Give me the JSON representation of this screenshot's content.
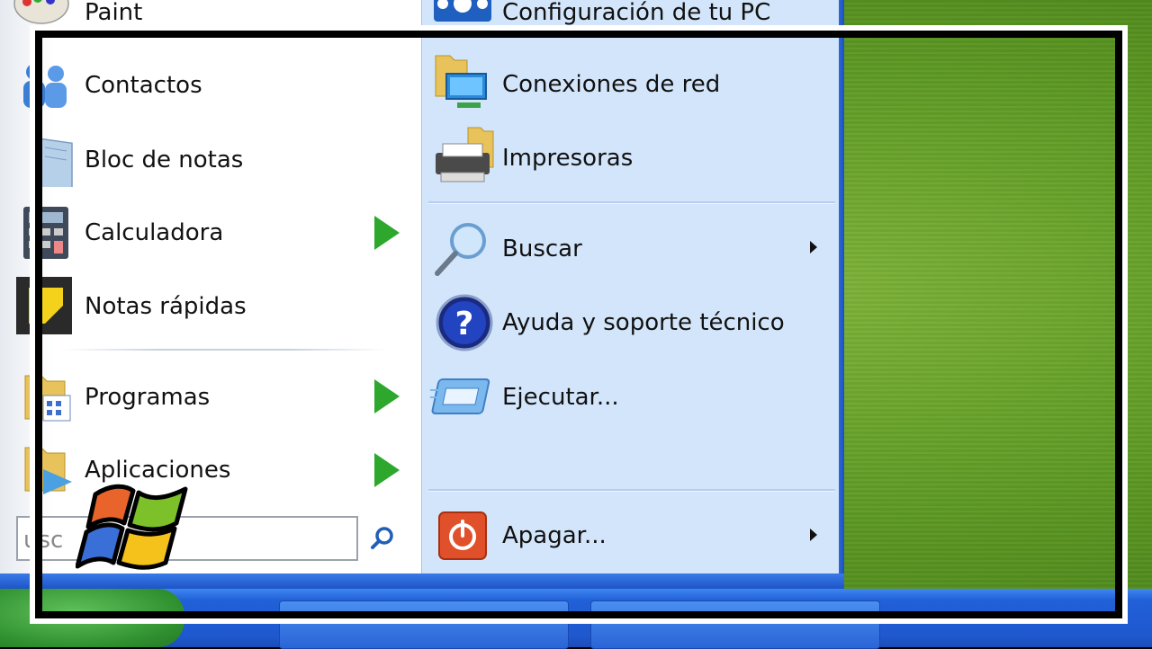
{
  "left_menu": {
    "items": [
      {
        "label": "Paint"
      },
      {
        "label": "Contactos"
      },
      {
        "label": "Bloc de notas"
      },
      {
        "label": "Calculadora"
      },
      {
        "label": "Notas rápidas"
      },
      {
        "label": "Programas"
      },
      {
        "label": "Aplicaciones"
      }
    ],
    "search_placeholder": "usc"
  },
  "right_menu": {
    "items": [
      {
        "label": "Configuración de tu PC"
      },
      {
        "label": "Conexiones de red"
      },
      {
        "label": "Impresoras"
      },
      {
        "label": "Buscar"
      },
      {
        "label": "Ayuda y soporte técnico"
      },
      {
        "label": "Ejecutar..."
      },
      {
        "label": "Apagar..."
      }
    ]
  },
  "colors": {
    "menu_left_bg": "#ffffff",
    "menu_right_bg": "#d3e5fa",
    "taskbar": "#2160d8",
    "start_button": "#2f8f2f",
    "submenu_arrow": "#2da82d"
  }
}
